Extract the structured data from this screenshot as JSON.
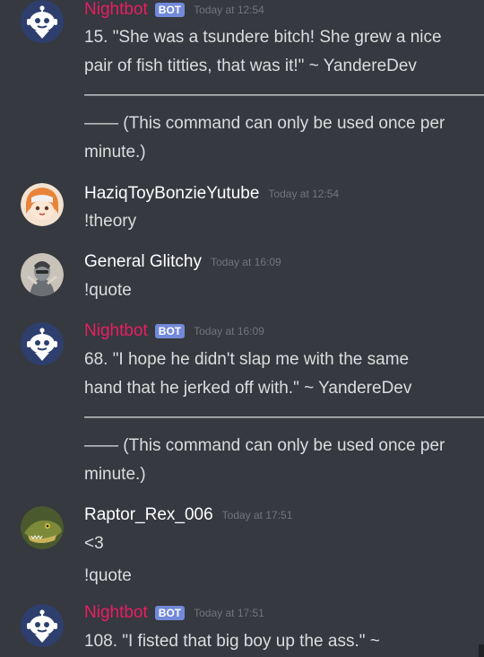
{
  "messages": [
    {
      "author": "Nightbot",
      "bot_tag": "BOT",
      "timestamp": "Today at 12:54",
      "lines": [
        "15. \"She was a tsundere bitch! She grew a nice",
        "pair of fish titties, that was it!\" ~ YandereDev",
        "————————————————————————",
        "—— (This command can only be used once per",
        "minute.)"
      ]
    },
    {
      "author": "HaziqToyBonzieYutube",
      "timestamp": "Today at 12:54",
      "lines": [
        "!theory"
      ]
    },
    {
      "author": "General Glitchy",
      "timestamp": "Today at 16:09",
      "lines": [
        "!quote"
      ]
    },
    {
      "author": "Nightbot",
      "bot_tag": "BOT",
      "timestamp": "Today at 16:09",
      "lines": [
        "68. \"I hope he didn't slap me with the same",
        "hand that he jerked off with.\" ~ YandereDev",
        "————————————————————————",
        "—— (This command can only be used once per",
        "minute.)"
      ]
    },
    {
      "author": "Raptor_Rex_006",
      "timestamp": "Today at 17:51",
      "lines": [
        "<3",
        "!quote"
      ]
    },
    {
      "author": "Nightbot",
      "bot_tag": "BOT",
      "timestamp": "Today at 17:51",
      "lines": [
        "108. \"I fisted that big boy up the ass.\" ~"
      ]
    }
  ]
}
